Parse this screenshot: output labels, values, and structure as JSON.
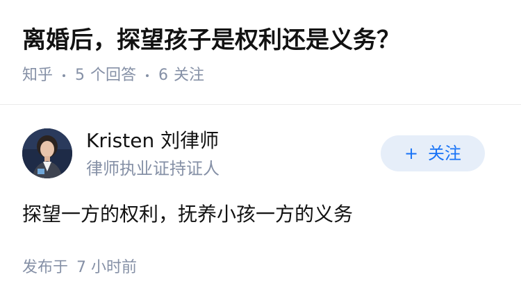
{
  "question": {
    "title": "离婚后，探望孩子是权利还是义务？",
    "source": "知乎",
    "answer_count": "5",
    "answer_label": "个回答",
    "follower_count": "6",
    "follower_label": "关注"
  },
  "answer": {
    "author": {
      "name": "Kristen 刘律师",
      "badge": "律师执业证持证人",
      "avatar_icon": "avatar-photo"
    },
    "follow_button": {
      "icon": "plus-icon",
      "plus": "+",
      "label": "关注"
    },
    "content": "探望一方的权利，抚养小孩一方的义务",
    "published_label": "发布于",
    "published_time": "7 小时前"
  },
  "colors": {
    "title": "#121212",
    "meta": "#8590a6",
    "follow_bg": "#e6eef9",
    "follow_text": "#1772f6",
    "divider": "#ebebeb"
  }
}
